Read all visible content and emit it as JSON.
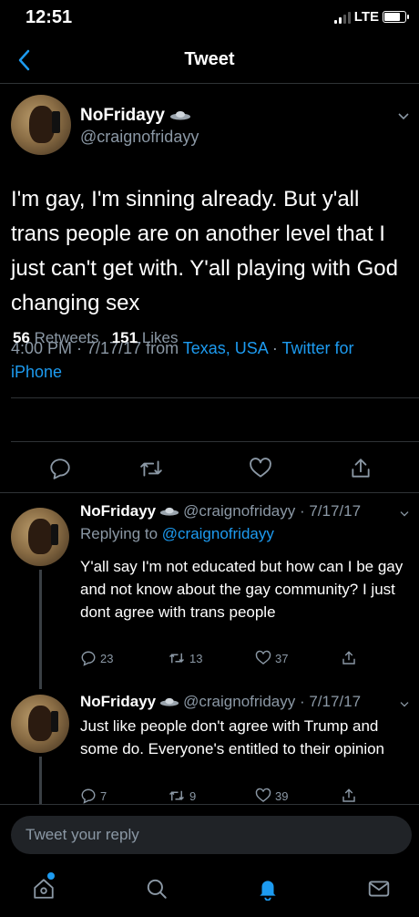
{
  "status": {
    "time": "12:51",
    "network": "LTE",
    "signal_bars": 2,
    "battery_level": 0.8
  },
  "header": {
    "title": "Tweet"
  },
  "main_tweet": {
    "name": "NoFridayy",
    "handle": "@craignofridayy",
    "text": "I'm gay, I'm sinning already. But y'all trans people are on another level that I just can't get with. Y'all playing with God changing sex",
    "time": "4:00 PM · 7/17/17 from ",
    "location": "Texas, USA",
    "separator": " · ",
    "source": "Twitter for iPhone",
    "retweets_count": "56",
    "retweets_label": "Retweets",
    "likes_count": "151",
    "likes_label": "Likes"
  },
  "replies": [
    {
      "name": "NoFridayy",
      "handle": "@craignofridayy · 7/17/17",
      "replying_label": "Replying to ",
      "replying_to": "@craignofridayy",
      "text": "Y'all say I'm not educated but how can I be gay and not know about the gay community? I just dont agree with trans people",
      "reply_count": "23",
      "retweet_count": "13",
      "like_count": "37"
    },
    {
      "name": "NoFridayy",
      "handle": "@craignofridayy · 7/17/17",
      "text": "Just like people don't agree with Trump and some do. Everyone's entitled to their opinion",
      "reply_count": "7",
      "retweet_count": "9",
      "like_count": "39"
    }
  ],
  "compose": {
    "placeholder": "Tweet your reply"
  },
  "tabs": [
    "home-icon",
    "search-icon",
    "notifications-icon",
    "messages-icon"
  ],
  "colors": {
    "accent": "#1d9bf0",
    "background": "#000000",
    "secondary_text": "#8b98a5",
    "divider": "#2f3336"
  }
}
